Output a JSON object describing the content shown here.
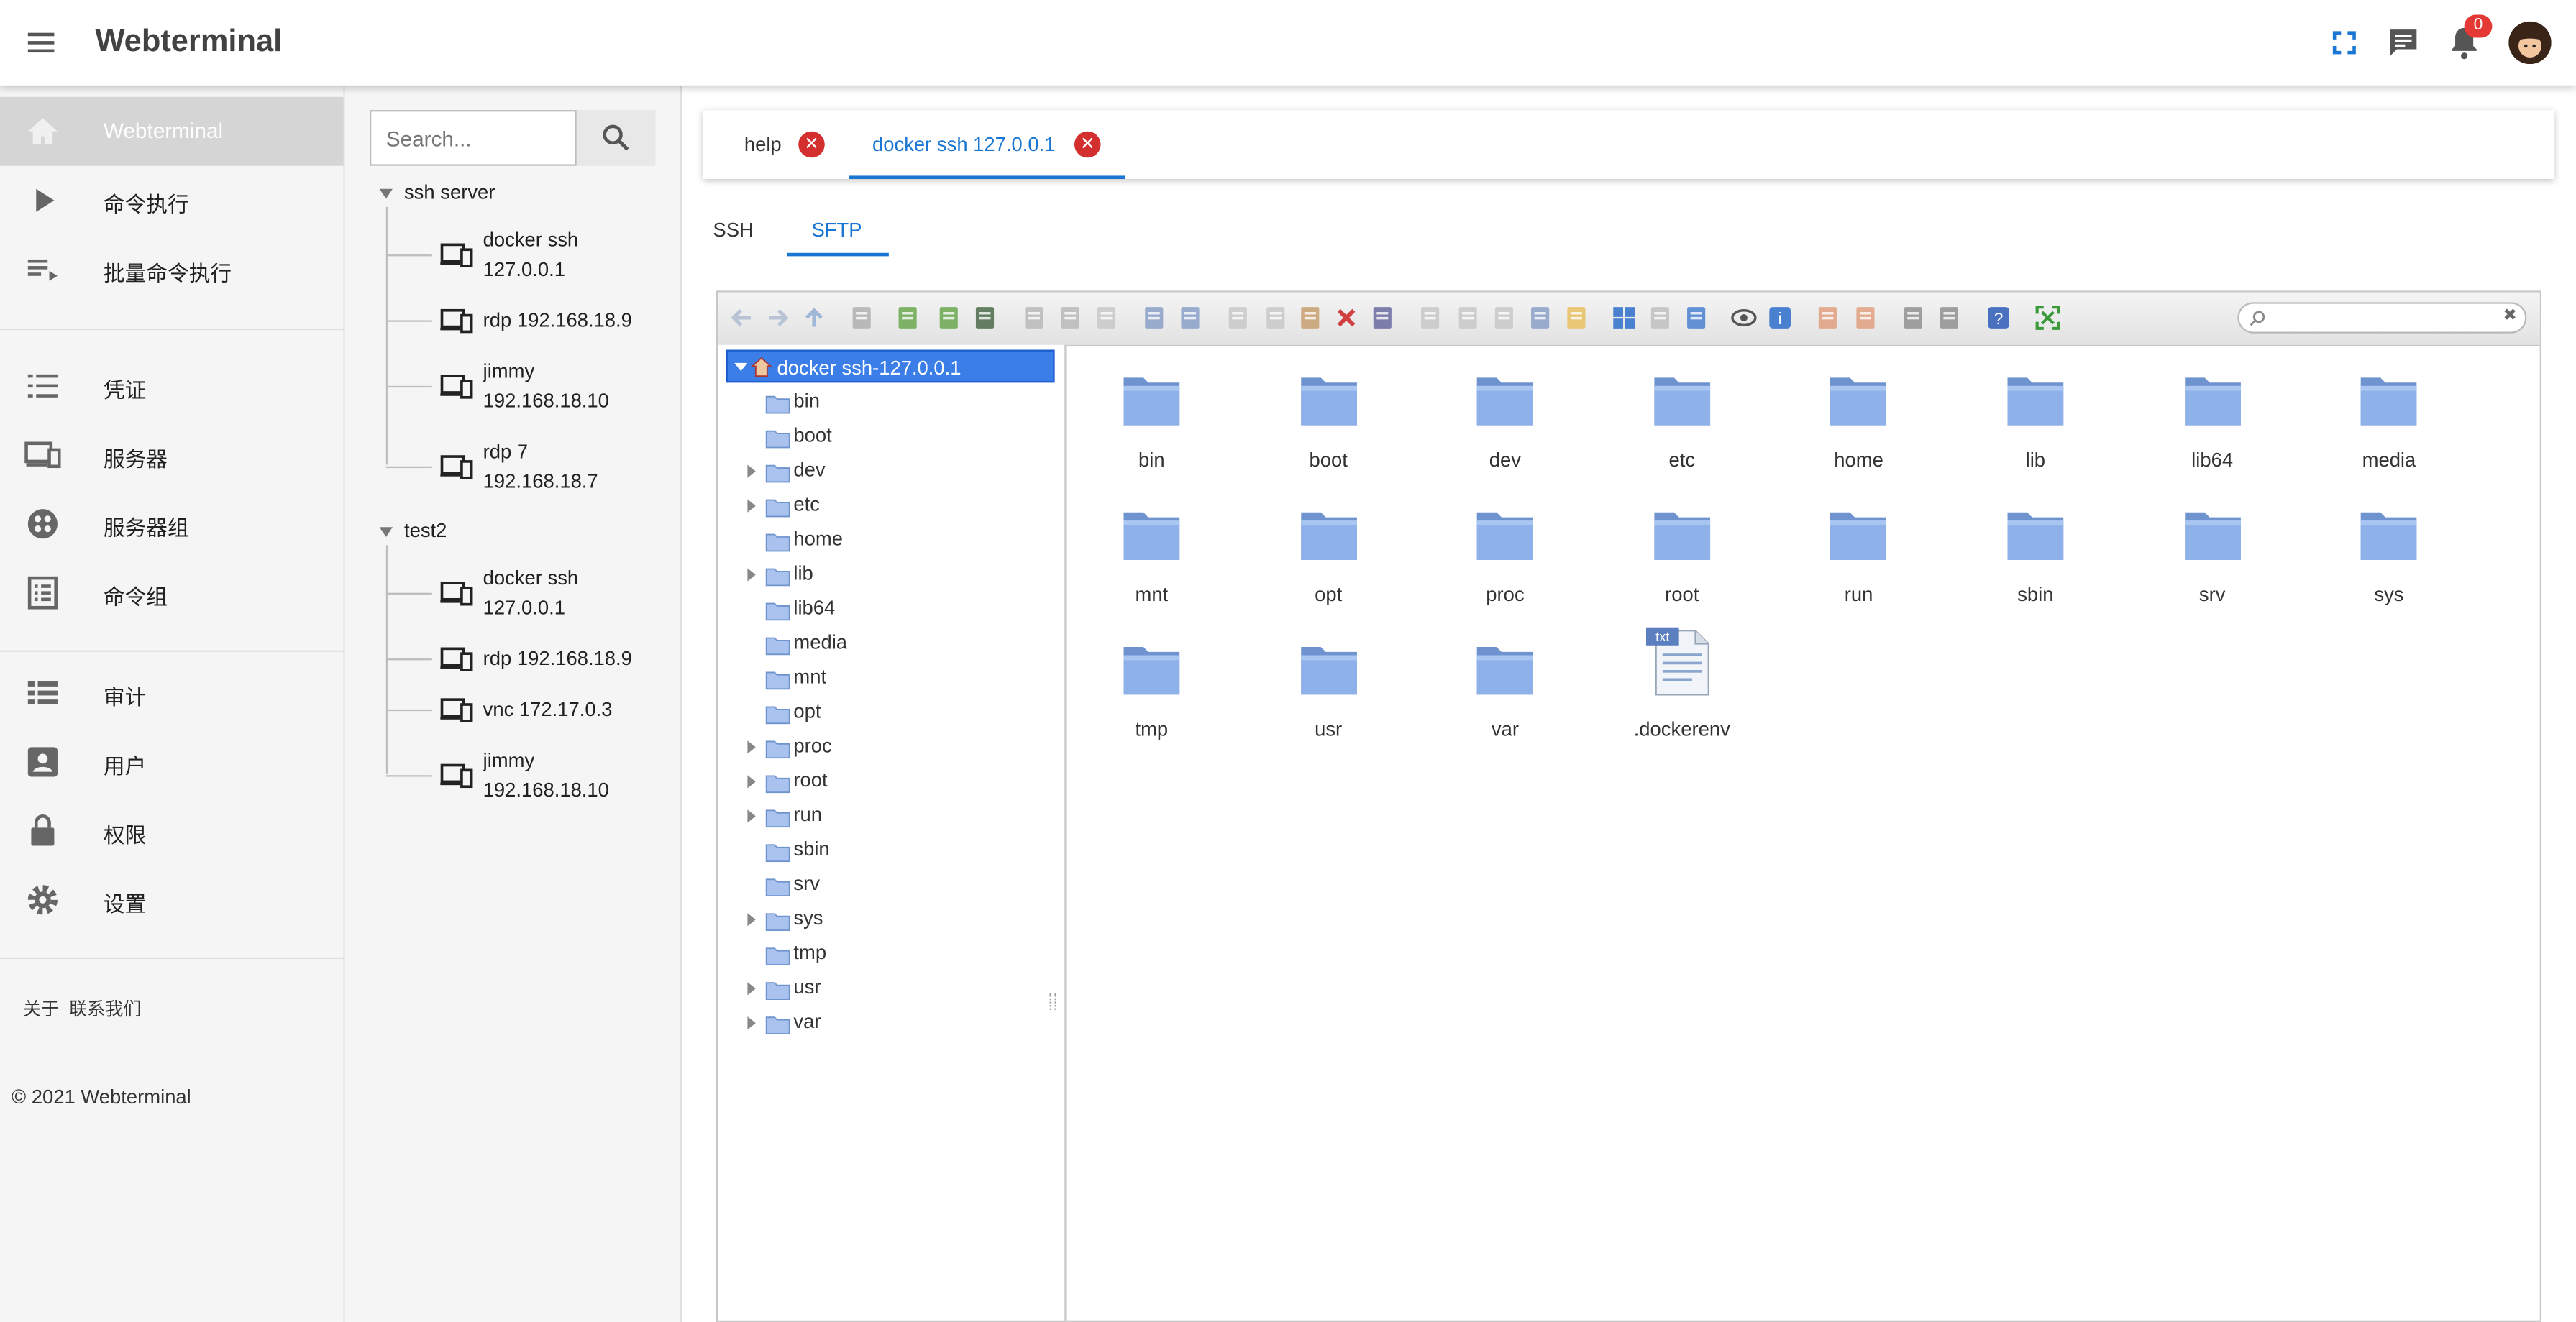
{
  "app": {
    "title": "Webterminal",
    "notification_count": "0"
  },
  "nav": {
    "items": [
      {
        "label": "Webterminal",
        "icon": "home-icon",
        "active": true
      },
      {
        "label": "命令执行",
        "icon": "play-icon"
      },
      {
        "label": "批量命令执行",
        "icon": "playlist-icon"
      },
      {
        "label": "凭证",
        "icon": "list-icon"
      },
      {
        "label": "服务器",
        "icon": "devices-icon"
      },
      {
        "label": "服务器组",
        "icon": "group-icon"
      },
      {
        "label": "命令组",
        "icon": "document-list-icon"
      },
      {
        "label": "审计",
        "icon": "audit-list-icon"
      },
      {
        "label": "用户",
        "icon": "user-icon"
      },
      {
        "label": "权限",
        "icon": "lock-icon"
      },
      {
        "label": "设置",
        "icon": "gear-icon"
      }
    ],
    "footer_links": [
      "关于",
      "联系我们"
    ],
    "copyright": "© 2021 Webterminal"
  },
  "server_tree": {
    "search_placeholder": "Search...",
    "groups": [
      {
        "name": "ssh server",
        "servers": [
          "docker ssh\n127.0.0.1",
          "rdp 192.168.18.9",
          "jimmy\n192.168.18.10",
          "rdp 7\n192.168.18.7"
        ]
      },
      {
        "name": "test2",
        "servers": [
          "docker ssh\n127.0.0.1",
          "rdp 192.168.18.9",
          "vnc 172.17.0.3",
          "jimmy\n192.168.18.10"
        ]
      }
    ]
  },
  "tabs": [
    {
      "label": "help",
      "active": false
    },
    {
      "label": "docker ssh 127.0.0.1",
      "active": true
    }
  ],
  "protocol_tabs": [
    {
      "label": "SSH",
      "active": false
    },
    {
      "label": "SFTP",
      "active": true
    }
  ],
  "file_manager": {
    "root": "docker ssh-127.0.0.1",
    "tree_dirs": [
      {
        "name": "bin",
        "expandable": false
      },
      {
        "name": "boot",
        "expandable": false
      },
      {
        "name": "dev",
        "expandable": true
      },
      {
        "name": "etc",
        "expandable": true
      },
      {
        "name": "home",
        "expandable": false
      },
      {
        "name": "lib",
        "expandable": true
      },
      {
        "name": "lib64",
        "expandable": false
      },
      {
        "name": "media",
        "expandable": false
      },
      {
        "name": "mnt",
        "expandable": false
      },
      {
        "name": "opt",
        "expandable": false
      },
      {
        "name": "proc",
        "expandable": true
      },
      {
        "name": "root",
        "expandable": true
      },
      {
        "name": "run",
        "expandable": true
      },
      {
        "name": "sbin",
        "expandable": false
      },
      {
        "name": "srv",
        "expandable": false
      },
      {
        "name": "sys",
        "expandable": true
      },
      {
        "name": "tmp",
        "expandable": false
      },
      {
        "name": "usr",
        "expandable": true
      },
      {
        "name": "var",
        "expandable": true
      }
    ],
    "files": [
      {
        "name": "bin",
        "type": "folder"
      },
      {
        "name": "boot",
        "type": "folder"
      },
      {
        "name": "dev",
        "type": "folder"
      },
      {
        "name": "etc",
        "type": "folder"
      },
      {
        "name": "home",
        "type": "folder"
      },
      {
        "name": "lib",
        "type": "folder"
      },
      {
        "name": "lib64",
        "type": "folder"
      },
      {
        "name": "media",
        "type": "folder"
      },
      {
        "name": "mnt",
        "type": "folder"
      },
      {
        "name": "opt",
        "type": "folder"
      },
      {
        "name": "proc",
        "type": "folder"
      },
      {
        "name": "root",
        "type": "folder"
      },
      {
        "name": "run",
        "type": "folder"
      },
      {
        "name": "sbin",
        "type": "folder"
      },
      {
        "name": "srv",
        "type": "folder"
      },
      {
        "name": "sys",
        "type": "folder"
      },
      {
        "name": "tmp",
        "type": "folder"
      },
      {
        "name": "usr",
        "type": "folder"
      },
      {
        "name": "var",
        "type": "folder"
      },
      {
        "name": ".dockerenv",
        "type": "txt",
        "badge": "txt"
      }
    ],
    "toolbar_icons": [
      "back-icon",
      "forward-icon",
      "up-icon",
      "home-dir-icon",
      "mkdir-icon",
      "mkfile-icon",
      "upload-icon",
      "open-icon",
      "download-icon",
      "select-icon",
      "undo-icon",
      "redo-icon",
      "copy-icon",
      "cut-icon",
      "paste-icon",
      "delete-icon",
      "empty-icon",
      "duplicate-icon",
      "rename-icon",
      "edit-icon",
      "resize-icon",
      "extract-icon",
      "icons-view-icon",
      "list-view-icon",
      "tree-view-icon",
      "preview-icon",
      "info-icon",
      "archive-icon",
      "extract-archive-icon",
      "sort-icon",
      "network-icon",
      "help-icon",
      "fullscreen-icon"
    ]
  },
  "colors": {
    "accent": "#1976d2",
    "selection": "#3b7ee8",
    "folder": "#7fa8e8",
    "danger": "#d32f2f"
  }
}
